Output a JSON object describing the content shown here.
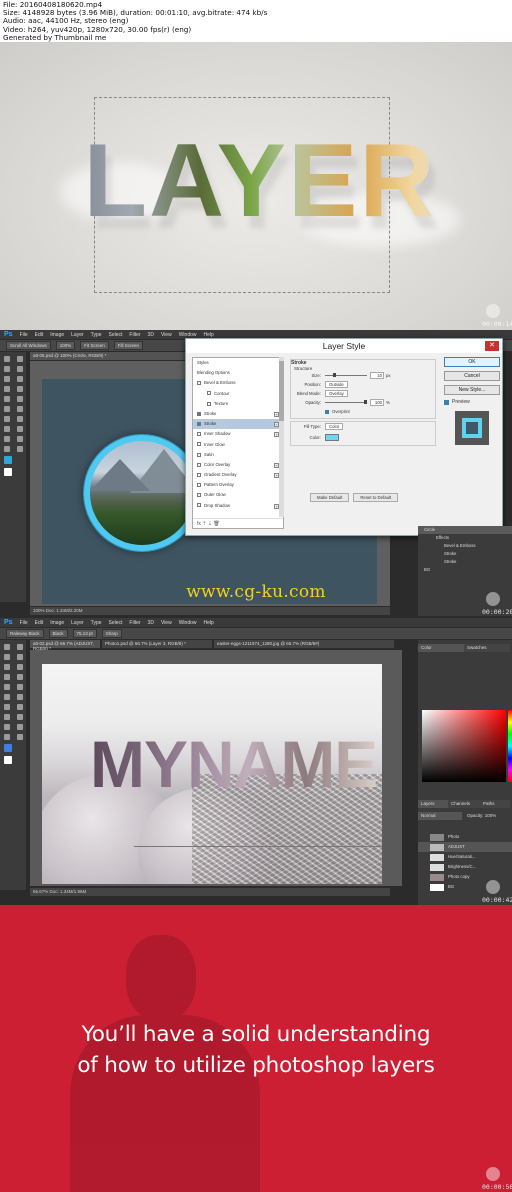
{
  "header": {
    "file": "File: 20160408180620.mp4",
    "size": "Size: 4148928 bytes (3.96 MiB), duration: 00:01:10, avg.bitrate: 474 kb/s",
    "audio": "Audio: aac, 44100 Hz, stereo (eng)",
    "video": "Video: h264, yuv420p, 1280x720, 30.00 fps(r) (eng)",
    "generated": "Generated by Thumbnail me"
  },
  "frames": {
    "f1_timestamp": "00:00:14",
    "f2_timestamp": "00:00:28",
    "f3_timestamp": "00:00:42",
    "f4_timestamp": "00:00:56"
  },
  "frame1": {
    "title": "LAYER"
  },
  "frame2": {
    "app_logo": "Ps",
    "menu": [
      "File",
      "Edit",
      "Image",
      "Layer",
      "Type",
      "Select",
      "Filter",
      "3D",
      "View",
      "Window",
      "Help"
    ],
    "options": [
      "Scroll All Windows",
      "100%",
      "Fit Screen",
      "Fill Screen"
    ],
    "doc_tab": "att-05.psd @ 100% (Circle, RGB/8) *",
    "status": "100%     Doc: 1.34M/2.20M",
    "dialog": {
      "title": "Layer Style",
      "close": "✕",
      "styles_header": "Styles",
      "styles": [
        {
          "label": "Blending Options",
          "checkbox": false,
          "plus": false,
          "sub": false,
          "selected": false
        },
        {
          "label": "Bevel & Emboss",
          "checkbox": true,
          "plus": false,
          "sub": false,
          "selected": false
        },
        {
          "label": "Contour",
          "checkbox": true,
          "plus": false,
          "sub": true,
          "selected": false
        },
        {
          "label": "Texture",
          "checkbox": true,
          "plus": false,
          "sub": true,
          "selected": false
        },
        {
          "label": "Stroke",
          "checkbox": true,
          "plus": true,
          "sub": false,
          "selected": false
        },
        {
          "label": "Stroke",
          "checkbox": true,
          "plus": true,
          "sub": false,
          "selected": true
        },
        {
          "label": "Inner Shadow",
          "checkbox": true,
          "plus": true,
          "sub": false,
          "selected": false
        },
        {
          "label": "Inner Glow",
          "checkbox": true,
          "plus": false,
          "sub": false,
          "selected": false
        },
        {
          "label": "Satin",
          "checkbox": true,
          "plus": false,
          "sub": false,
          "selected": false
        },
        {
          "label": "Color Overlay",
          "checkbox": true,
          "plus": true,
          "sub": false,
          "selected": false
        },
        {
          "label": "Gradient Overlay",
          "checkbox": true,
          "plus": true,
          "sub": false,
          "selected": false
        },
        {
          "label": "Pattern Overlay",
          "checkbox": true,
          "plus": false,
          "sub": false,
          "selected": false
        },
        {
          "label": "Outer Glow",
          "checkbox": true,
          "plus": false,
          "sub": false,
          "selected": false
        },
        {
          "label": "Drop Shadow",
          "checkbox": true,
          "plus": true,
          "sub": false,
          "selected": false
        }
      ],
      "footer": "fx  ⇡  ⇣  🗑",
      "stroke": {
        "heading": "Stroke",
        "structure": "Structure",
        "size_label": "Size:",
        "size_value": "10",
        "size_unit": "px",
        "position_label": "Position:",
        "position_value": "Outside",
        "blend_label": "Blend Mode:",
        "blend_value": "Overlay",
        "opacity_label": "Opacity:",
        "opacity_value": "100",
        "opacity_unit": "%",
        "overprint": "Overprint",
        "fill_type_label": "Fill Type:",
        "fill_type_value": "Color",
        "color_label": "Color:",
        "make_default": "Make Default",
        "reset_default": "Reset to Default"
      },
      "buttons": {
        "ok": "OK",
        "cancel": "Cancel",
        "new_style": "New Style...",
        "preview": "Preview"
      }
    },
    "layers": [
      "Circle",
      "Effects",
      "Bevel & Emboss",
      "Stroke",
      "Stroke",
      "BG"
    ],
    "watermark": "www.cg-ku.com"
  },
  "frame3": {
    "tool_options": [
      "Raleway Black",
      "Black",
      "75.13 pt",
      "Sharp"
    ],
    "doc_tabs": [
      "att-02.psd @ 66.7% (ADJUST, RGB/8) *",
      "Photo1.psd @ 66.7% (Layer 3, RGB/8) *",
      "easter-eggs-1211574_1280.jpg @ 66.7% (RGB/8#)"
    ],
    "status": "66.67%   Doc: 1.34M/1.96M",
    "canvas_text": "MYNAME",
    "panel_tabs": [
      "Color",
      "Swatches"
    ],
    "layer_tabs": [
      "Layers",
      "Channels",
      "Paths"
    ],
    "blend": "Normal",
    "opacity": "Opacity: 100%",
    "layers": [
      "Photo",
      "ADJUST",
      "Hue/Saturati...",
      "Brightness/C...",
      "Photo copy",
      "BG"
    ]
  },
  "frame4": {
    "line1": "You’ll have a solid understanding",
    "line2": "of how to utilize photoshop layers",
    "bg_color": "#cc1f34"
  }
}
